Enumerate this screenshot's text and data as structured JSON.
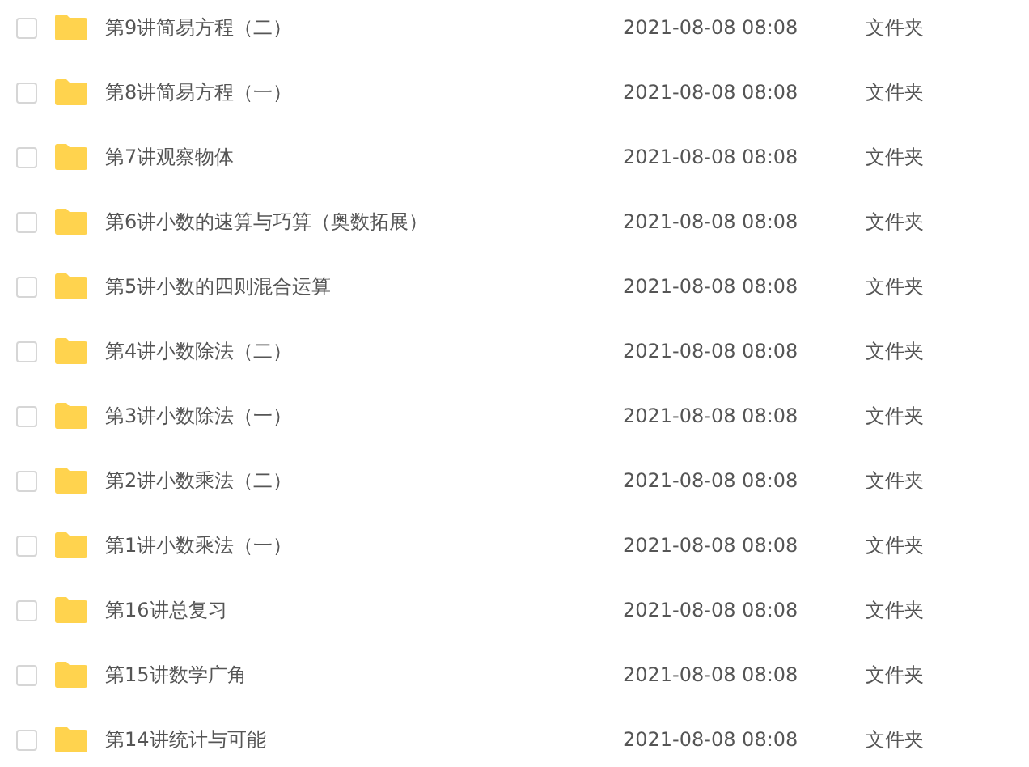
{
  "files": [
    {
      "name": "第9讲简易方程（二）",
      "modified": "2021-08-08 08:08",
      "type": "文件夹",
      "checked": false
    },
    {
      "name": "第8讲简易方程（一）",
      "modified": "2021-08-08 08:08",
      "type": "文件夹",
      "checked": false
    },
    {
      "name": "第7讲观察物体",
      "modified": "2021-08-08 08:08",
      "type": "文件夹",
      "checked": false
    },
    {
      "name": "第6讲小数的速算与巧算（奥数拓展）",
      "modified": "2021-08-08 08:08",
      "type": "文件夹",
      "checked": false
    },
    {
      "name": "第5讲小数的四则混合运算",
      "modified": "2021-08-08 08:08",
      "type": "文件夹",
      "checked": false
    },
    {
      "name": "第4讲小数除法（二）",
      "modified": "2021-08-08 08:08",
      "type": "文件夹",
      "checked": false
    },
    {
      "name": "第3讲小数除法（一）",
      "modified": "2021-08-08 08:08",
      "type": "文件夹",
      "checked": false
    },
    {
      "name": "第2讲小数乘法（二）",
      "modified": "2021-08-08 08:08",
      "type": "文件夹",
      "checked": false
    },
    {
      "name": "第1讲小数乘法（一）",
      "modified": "2021-08-08 08:08",
      "type": "文件夹",
      "checked": false
    },
    {
      "name": "第16讲总复习",
      "modified": "2021-08-08 08:08",
      "type": "文件夹",
      "checked": false
    },
    {
      "name": "第15讲数学广角",
      "modified": "2021-08-08 08:08",
      "type": "文件夹",
      "checked": false
    },
    {
      "name": "第14讲统计与可能",
      "modified": "2021-08-08 08:08",
      "type": "文件夹",
      "checked": false
    }
  ]
}
